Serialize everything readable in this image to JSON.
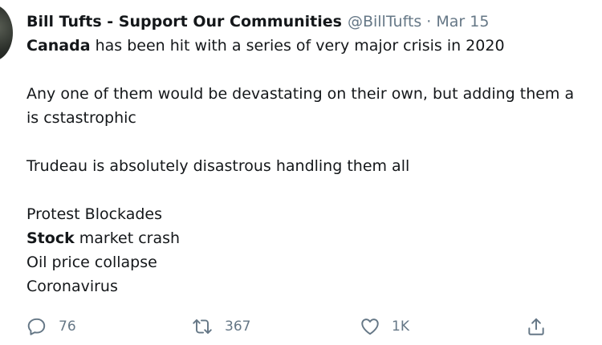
{
  "tweet": {
    "author_name": "Bill Tufts - Support Our Communities",
    "handle": "@BillTufts",
    "separator": "·",
    "date": "Mar 15",
    "lines": [
      {
        "bold": "Canada",
        "text": " has been hit with a series of very major crisis in 2020"
      },
      {
        "text": "Any one of them would be devastating on their own, but adding them a"
      },
      {
        "text": "is cstastrophic"
      },
      {
        "text": "Trudeau is absolutely disastrous handling them all"
      },
      {
        "text": "Protest Blockades"
      },
      {
        "bold": "Stock",
        "text": " market crash"
      },
      {
        "text": "Oil price collapse"
      },
      {
        "text": "Coronavirus"
      }
    ],
    "actions": {
      "reply": {
        "icon": "reply-icon",
        "count": "76"
      },
      "retweet": {
        "icon": "retweet-icon",
        "count": "367"
      },
      "like": {
        "icon": "heart-icon",
        "count": "1K"
      },
      "share": {
        "icon": "share-icon"
      }
    }
  },
  "colors": {
    "text": "#14171a",
    "secondary": "#657786"
  }
}
